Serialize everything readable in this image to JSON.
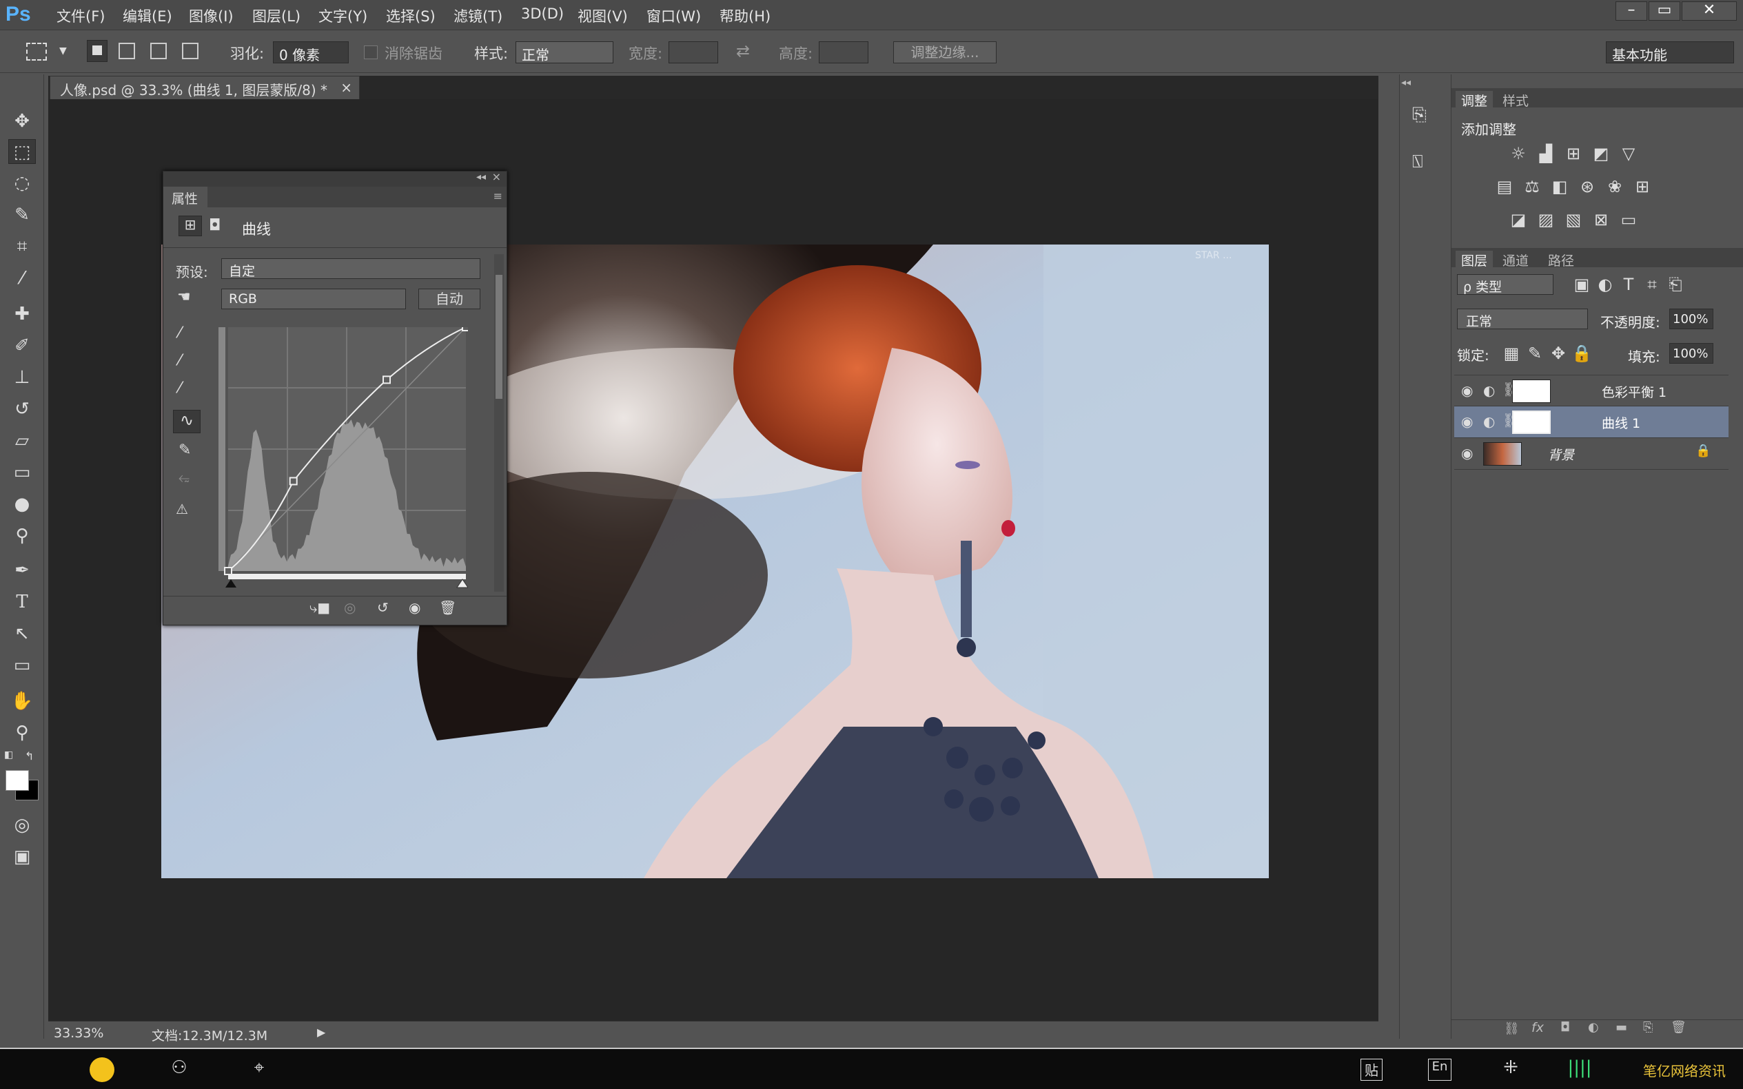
{
  "app": {
    "logo": "Ps"
  },
  "menu": [
    "文件(F)",
    "编辑(E)",
    "图像(I)",
    "图层(L)",
    "文字(Y)",
    "选择(S)",
    "滤镜(T)",
    "3D(D)",
    "视图(V)",
    "窗口(W)",
    "帮助(H)"
  ],
  "window_controls": {
    "minimize": "–",
    "restore": "▭",
    "close": "✕"
  },
  "options": {
    "feather_label": "羽化:",
    "feather_value": "0 像素",
    "antialias_label": "消除锯齿",
    "style_label": "样式:",
    "style_value": "正常",
    "width_label": "宽度:",
    "height_label": "高度:",
    "refine_button": "调整边缘...",
    "workspace": "基本功能"
  },
  "document": {
    "tab_title": "人像.psd @ 33.3% (曲线 1, 图层蒙版/8) *",
    "tab_close": "×",
    "watermark": "STAR ..."
  },
  "properties": {
    "title": "属性",
    "panel_name": "曲线",
    "preset_label": "预设:",
    "preset_value": "自定",
    "channel_value": "RGB",
    "auto_button": "自动"
  },
  "curve": {
    "points": [
      [
        0,
        0
      ],
      [
        70,
        94
      ],
      [
        170,
        200
      ],
      [
        255,
        255
      ]
    ],
    "histogram_peaks": [
      [
        30,
        190
      ],
      [
        120,
        170
      ],
      [
        160,
        160
      ]
    ]
  },
  "adjustments": {
    "tabs": [
      "调整",
      "样式"
    ],
    "title": "添加调整"
  },
  "layers_panel": {
    "tabs": [
      "图层",
      "通道",
      "路径"
    ],
    "filter": "ρ 类型",
    "blend_mode": "正常",
    "opacity_label": "不透明度:",
    "opacity_value": "100%",
    "lock_label": "锁定:",
    "fill_label": "填充:",
    "fill_value": "100%",
    "layers": [
      {
        "name": "色彩平衡 1",
        "selected": false
      },
      {
        "name": "曲线 1",
        "selected": true
      },
      {
        "name": "背景",
        "selected": false
      }
    ]
  },
  "status": {
    "zoom": "33.33%",
    "doc_info": "文档:12.3M/12.3M"
  },
  "taskbar": {
    "tray_text": "笔亿网络资讯",
    "en": "En",
    "bd": "贴"
  }
}
